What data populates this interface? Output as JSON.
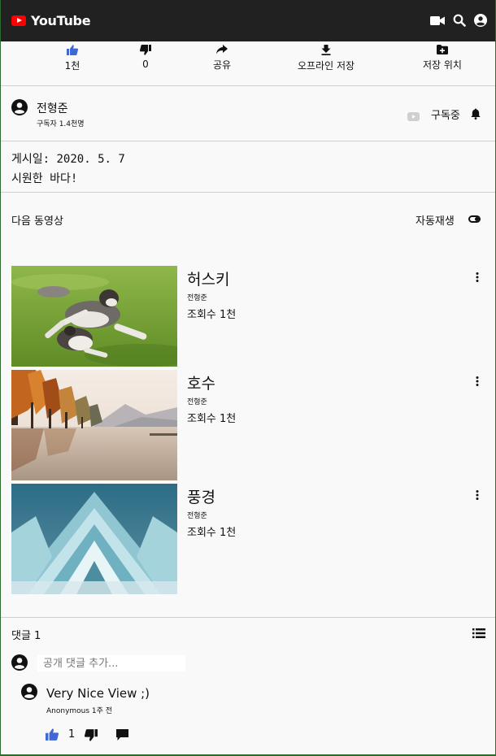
{
  "header": {
    "logo_text": "YouTube",
    "icons": [
      "video-camera-icon",
      "search-icon",
      "account-icon"
    ]
  },
  "actions": [
    {
      "icon": "thumb-up-icon",
      "label": "1천"
    },
    {
      "icon": "thumb-down-icon",
      "label": "0"
    },
    {
      "icon": "share-icon",
      "label": "공유"
    },
    {
      "icon": "download-icon",
      "label": "오프라인 저장"
    },
    {
      "icon": "save-to-icon",
      "label": "저장 위치"
    }
  ],
  "channel": {
    "name": "전형준",
    "subscribers": "구독자 1.4천명",
    "subscribe_label": "구독중"
  },
  "description": {
    "date": "게시일: 2020. 5. 7",
    "text": "시원한 바다!"
  },
  "up_next": {
    "label": "다음 동영상",
    "autoplay_label": "자동재생"
  },
  "videos": [
    {
      "title": "허스키",
      "channel": "전형준",
      "views": "조회수 1천"
    },
    {
      "title": "호수",
      "channel": "전형준",
      "views": "조회수 1천"
    },
    {
      "title": "풍경",
      "channel": "전형준",
      "views": "조회수 1천"
    }
  ],
  "comments": {
    "count_label": "댓글 1",
    "input_placeholder": "공개 댓글 추가...",
    "items": [
      {
        "text": "Very Nice View ;)",
        "meta": "Anonymous 1주 전",
        "likes": "1"
      }
    ]
  },
  "colors": {
    "topbar": "#212121",
    "brand": "#ff0000",
    "like_active": "#3f68d6"
  }
}
